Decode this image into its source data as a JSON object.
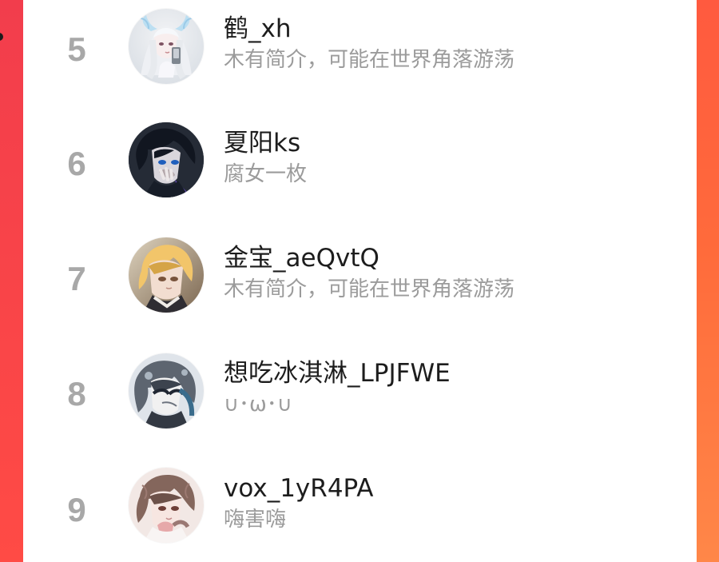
{
  "theme": {
    "background_left": "#f5474a",
    "background_right": "#ff6d3b",
    "card": "#ffffff",
    "rank_color": "#a8a8a8",
    "name_color": "#1d1d1d",
    "bio_color": "#9b9b9b"
  },
  "list": {
    "items": [
      {
        "rank": "5",
        "name": "鹤_xh",
        "bio": "木有简介，可能在世界角落游荡",
        "avatar_icon": "avatar-silver-haired-girl-icon"
      },
      {
        "rank": "6",
        "name": "夏阳ks",
        "bio": "腐女一枚",
        "avatar_icon": "avatar-dark-haired-boy-icon"
      },
      {
        "rank": "7",
        "name": "金宝_aeQvtQ",
        "bio": "木有简介，可能在世界角落游荡",
        "avatar_icon": "avatar-blond-character-icon"
      },
      {
        "rank": "8",
        "name": "想吃冰淇淋_LPJFWE",
        "bio": "∪･ω･∪",
        "avatar_icon": "avatar-sketch-character-icon"
      },
      {
        "rank": "9",
        "name": "vox_1yR4PA",
        "bio": "嗨害嗨",
        "avatar_icon": "avatar-brown-haired-girl-icon"
      }
    ]
  }
}
